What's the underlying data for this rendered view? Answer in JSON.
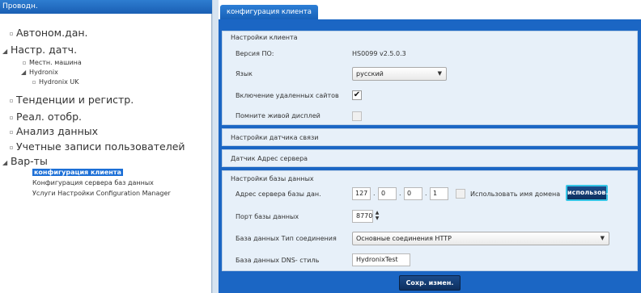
{
  "explorer": {
    "header": "Проводн.",
    "tree": [
      {
        "label": "Автоном.дан.",
        "level": 0,
        "glyph": ""
      },
      {
        "label": "Настр. датч.",
        "level": 0,
        "glyph": "◢"
      },
      {
        "label": "Местн. машина",
        "level": 1,
        "glyph": ""
      },
      {
        "label": "Hydronix",
        "level": 1,
        "glyph": "◢"
      },
      {
        "label": "Hydronix UK",
        "level": 2,
        "glyph": ""
      },
      {
        "label": "Тенденции и регистр.",
        "level": 0,
        "glyph": ""
      },
      {
        "label": "Реал. отобр.",
        "level": 0,
        "glyph": ""
      },
      {
        "label": "Анализ данных",
        "level": 0,
        "glyph": ""
      },
      {
        "label": "Учетные записи пользователей",
        "level": 0,
        "glyph": ""
      },
      {
        "label": "Вар-ты",
        "level": 0,
        "glyph": "◢"
      },
      {
        "label": "конфигурация клиента",
        "level": 1,
        "glyph": ""
      },
      {
        "label": "Конфигурация сервера баз данных",
        "level": 1,
        "glyph": ""
      },
      {
        "label": "Услуги Настройки Configuration Manager",
        "level": 1,
        "glyph": ""
      }
    ]
  },
  "tab": {
    "label": "конфигурация клиента"
  },
  "client_settings": {
    "title": "Настройки клиента",
    "version_label": "Версия ПО:",
    "version_value": "HS0099 v2.5.0.3",
    "language_label": "Язык",
    "language_value": "русский",
    "remote_sites_label": "Включение удаленных сайтов",
    "remote_sites_checked": true,
    "live_display_label": "Помните живой дисплей",
    "live_display_checked": false
  },
  "link_settings": {
    "title": "Настройки датчика связи"
  },
  "sensor_server": {
    "title": "Датчик Адрес сервера"
  },
  "database_settings": {
    "title": "Настройки базы данных",
    "server_address_label": "Адрес сервера базы дан.",
    "ip": [
      "127",
      "0",
      "0",
      "1"
    ],
    "use_domain_label": "Использовать имя домена",
    "use_button_label": "использов.",
    "port_label": "Порт базы данных",
    "port_value": "8770",
    "connection_type_label": "База данных Тип соединения",
    "connection_type_value": "Основные соединения HTTP",
    "dns_label": "База данных DNS- стиль",
    "dns_value": "HydronixTest"
  },
  "save_button_label": "Сохр. измен.",
  "colors": {
    "accent": "#1b66c4",
    "panel": "#e7f0f9",
    "button": "#1b4b8a",
    "highlight": "#35c5e6"
  }
}
